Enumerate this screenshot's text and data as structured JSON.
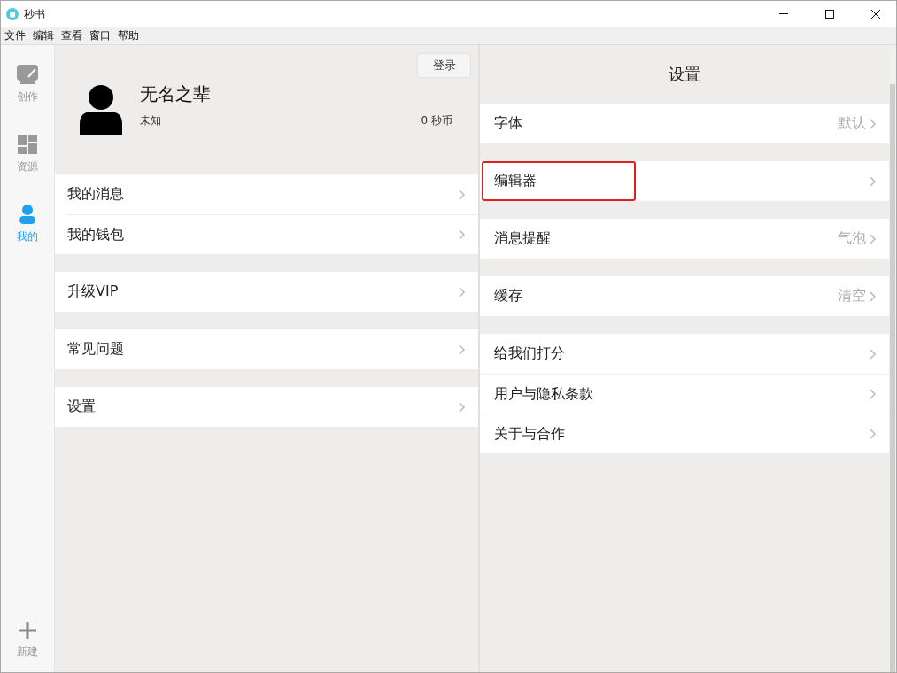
{
  "window": {
    "title": "秒书"
  },
  "menu_bar": [
    "文件",
    "编辑",
    "查看",
    "窗口",
    "帮助"
  ],
  "sidebar": {
    "items": [
      {
        "kind": "write",
        "label": "创作",
        "selected": false
      },
      {
        "kind": "resources",
        "label": "资源",
        "selected": false
      },
      {
        "kind": "me",
        "label": "我的",
        "selected": true
      }
    ],
    "new_button": {
      "label": "新建"
    }
  },
  "profile": {
    "login_button": "登录",
    "name": "无名之辈",
    "subtitle": "未知",
    "coins": "0 秒币"
  },
  "profile_groups": [
    [
      {
        "label": "我的消息"
      },
      {
        "label": "我的钱包"
      }
    ],
    [
      {
        "label": "升级VIP"
      }
    ],
    [
      {
        "label": "常见问题"
      }
    ],
    [
      {
        "label": "设置"
      }
    ]
  ],
  "settings": {
    "title": "设置",
    "groups": [
      [
        {
          "label": "字体",
          "value": "默认",
          "highlighted": false
        }
      ],
      [
        {
          "label": "编辑器",
          "highlighted": true
        }
      ],
      [
        {
          "label": "消息提醒",
          "value": "气泡",
          "highlighted": false
        }
      ],
      [
        {
          "label": "缓存",
          "value": "清空",
          "highlighted": false
        }
      ],
      [
        {
          "label": "给我们打分",
          "highlighted": false
        },
        {
          "label": "用户与隐私条款",
          "highlighted": false
        },
        {
          "label": "关于与合作",
          "highlighted": false
        }
      ]
    ]
  }
}
